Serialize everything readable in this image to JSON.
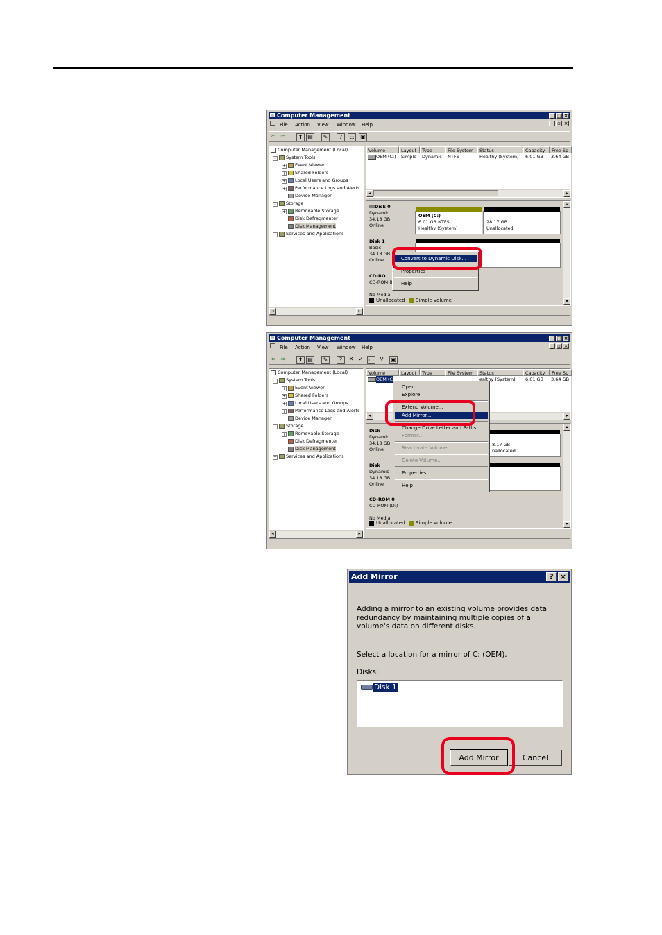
{
  "window1": {
    "title": "Computer Management",
    "menu": [
      "File",
      "Action",
      "View",
      "Window",
      "Help"
    ],
    "tree": [
      "Computer Management (Local)",
      "System Tools",
      "Event Viewer",
      "Shared Folders",
      "Local Users and Groups",
      "Performance Logs and Alerts",
      "Device Manager",
      "Storage",
      "Removable Storage",
      "Disk Defragmenter",
      "Disk Management",
      "Services and Applications"
    ],
    "columns": [
      "Volume",
      "Layout",
      "Type",
      "File System",
      "Status",
      "Capacity",
      "Free Sp"
    ],
    "row": [
      "OEM (C:)",
      "Simple",
      "Dynamic",
      "NTFS",
      "Healthy (System)",
      "6.01 GB",
      "3.64 GB"
    ],
    "disk0": {
      "name": "Disk 0",
      "type": "Dynamic",
      "size": "34.18 GB",
      "state": "Online",
      "part1": [
        "OEM  (C:)",
        "6.01 GB NTFS",
        "Healthy (System)"
      ],
      "part2": [
        "28.17 GB",
        "Unallocated"
      ]
    },
    "disk1": {
      "name": "Disk 1",
      "type": "Basic",
      "size": "34.18 GB",
      "state": "Online"
    },
    "cdrom": {
      "name": "CD-RO",
      "sub": "CD-ROM (D",
      "state": "No Media"
    },
    "context": {
      "selected": "Convert to Dynamic Disk...",
      "hidden": "Properties",
      "help": "Help"
    },
    "legend": [
      "Unallocated",
      "Simple volume"
    ]
  },
  "window2": {
    "title": "Computer Management",
    "menu": [
      "File",
      "Action",
      "View",
      "Window",
      "Help"
    ],
    "tree": [
      "Computer Management (Local)",
      "System Tools",
      "Event Viewer",
      "Shared Folders",
      "Local Users and Groups",
      "Performance Logs and Alerts",
      "Device Manager",
      "Storage",
      "Removable Storage",
      "Disk Defragmenter",
      "Disk Management",
      "Services and Applications"
    ],
    "columns": [
      "Volume",
      "Layout",
      "Type",
      "File System",
      "Status",
      "Capacity",
      "Free Sp"
    ],
    "row_vol": "OEM (C",
    "row_status": "ealthy (System)",
    "row_cap": "6.01 GB",
    "row_free": "3.64 GB",
    "disk_a": {
      "name": "Disk",
      "type": "Dynamic",
      "size": "34.18 GB",
      "state": "Online",
      "frag1": "8.17 GB",
      "frag2": "nallocated"
    },
    "disk_b": {
      "name": "Disk",
      "type": "Dynamic",
      "size": "34.18 GB",
      "state": "Online"
    },
    "cdrom": {
      "name": "CD-ROM 0",
      "sub": "CD-ROM (D:)",
      "state": "No Media"
    },
    "context": [
      "Open",
      "Explore",
      "Extend Volume...",
      "Add Mirror...",
      "Change Drive Letter and Paths...",
      "Format...",
      "Reactivate Volume",
      "Delete Volume...",
      "Properties",
      "Help"
    ],
    "legend": [
      "Unallocated",
      "Simple volume"
    ]
  },
  "dialog": {
    "title": "Add Mirror",
    "help_btn": "?",
    "close_btn": "×",
    "desc": "Adding a mirror to an existing volume provides data redundancy by maintaining multiple copies of a volume's data on different disks.",
    "prompt": "Select a location for a mirror of C: (OEM).",
    "disks_label": "Disks:",
    "disk_item": "Disk 1",
    "ok": "Add Mirror",
    "cancel": "Cancel"
  },
  "colors": {
    "title_bar": "#0a246a",
    "highlight": "#e8001e",
    "simple_volume": "#8b8b00",
    "unallocated": "#000000"
  }
}
